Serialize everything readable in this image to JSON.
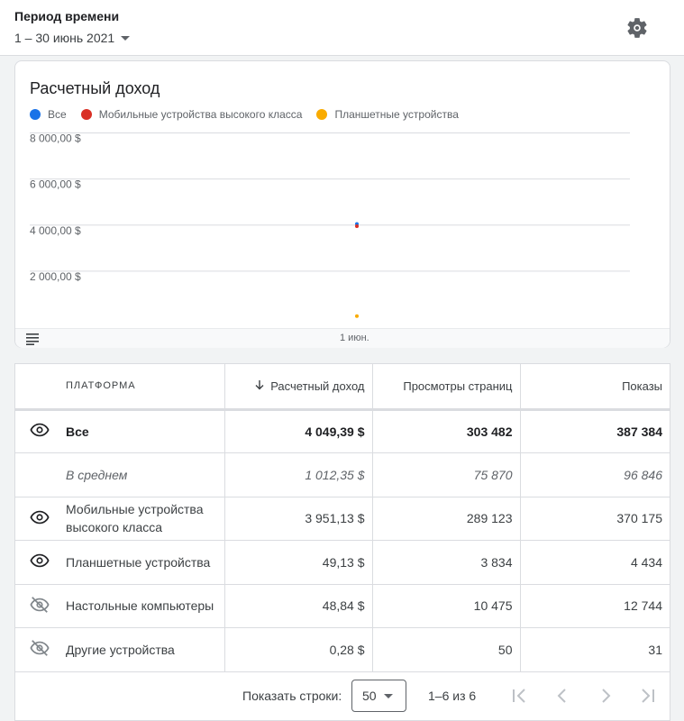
{
  "header": {
    "period_label": "Период времени",
    "period_value": "1 – 30 июнь 2021",
    "settings_icon": "gear-icon"
  },
  "chart": {
    "title": "Расчетный доход",
    "legend": [
      {
        "label": "Все",
        "color": "#1a73e8"
      },
      {
        "label": "Мобильные устройства высокого класса",
        "color": "#d93025"
      },
      {
        "label": "Планшетные устройства",
        "color": "#f9ab00"
      }
    ],
    "y_ticks": [
      "8 000,00 $",
      "6 000,00 $",
      "4 000,00 $",
      "2 000,00 $"
    ],
    "x_tick": "1 июн.",
    "table_toggle_icon": "list-icon"
  },
  "chart_data": {
    "type": "line",
    "title": "Расчетный доход",
    "x": [
      "1 июн."
    ],
    "ylim": [
      0,
      9000
    ],
    "y_tick_values": [
      2000,
      4000,
      6000,
      8000
    ],
    "grid": true,
    "legend_position": "top-left",
    "series": [
      {
        "name": "Все",
        "color": "#1a73e8",
        "values": [
          4049.39
        ]
      },
      {
        "name": "Мобильные устройства высокого класса",
        "color": "#d93025",
        "values": [
          3951.13
        ]
      },
      {
        "name": "Планшетные устройства",
        "color": "#f9ab00",
        "values": [
          49.13
        ]
      }
    ]
  },
  "table": {
    "headers": {
      "platform": "ПЛАТФОРМА",
      "revenue": "Расчетный доход",
      "pageviews": "Просмотры страниц",
      "impressions": "Показы"
    },
    "rows": [
      {
        "icon": "eye-icon",
        "name": "Все",
        "revenue": "4 049,39 $",
        "pageviews": "303 482",
        "impressions": "387 384",
        "style": "bold"
      },
      {
        "icon": "",
        "name": "В среднем",
        "revenue": "1 012,35 $",
        "pageviews": "75 870",
        "impressions": "96 846",
        "style": "italic"
      },
      {
        "icon": "eye-icon",
        "name": "Мобильные устройства высокого класса",
        "revenue": "3 951,13 $",
        "pageviews": "289 123",
        "impressions": "370 175",
        "style": ""
      },
      {
        "icon": "eye-icon",
        "name": "Планшетные устройства",
        "revenue": "49,13 $",
        "pageviews": "3 834",
        "impressions": "4 434",
        "style": ""
      },
      {
        "icon": "eye-off-icon",
        "name": "Настольные компьютеры",
        "revenue": "48,84 $",
        "pageviews": "10 475",
        "impressions": "12 744",
        "style": ""
      },
      {
        "icon": "eye-off-icon",
        "name": "Другие устройства",
        "revenue": "0,28 $",
        "pageviews": "50",
        "impressions": "31",
        "style": ""
      }
    ]
  },
  "pagination": {
    "rows_label": "Показать строки:",
    "rows_value": "50",
    "range": "1–6 из 6"
  }
}
